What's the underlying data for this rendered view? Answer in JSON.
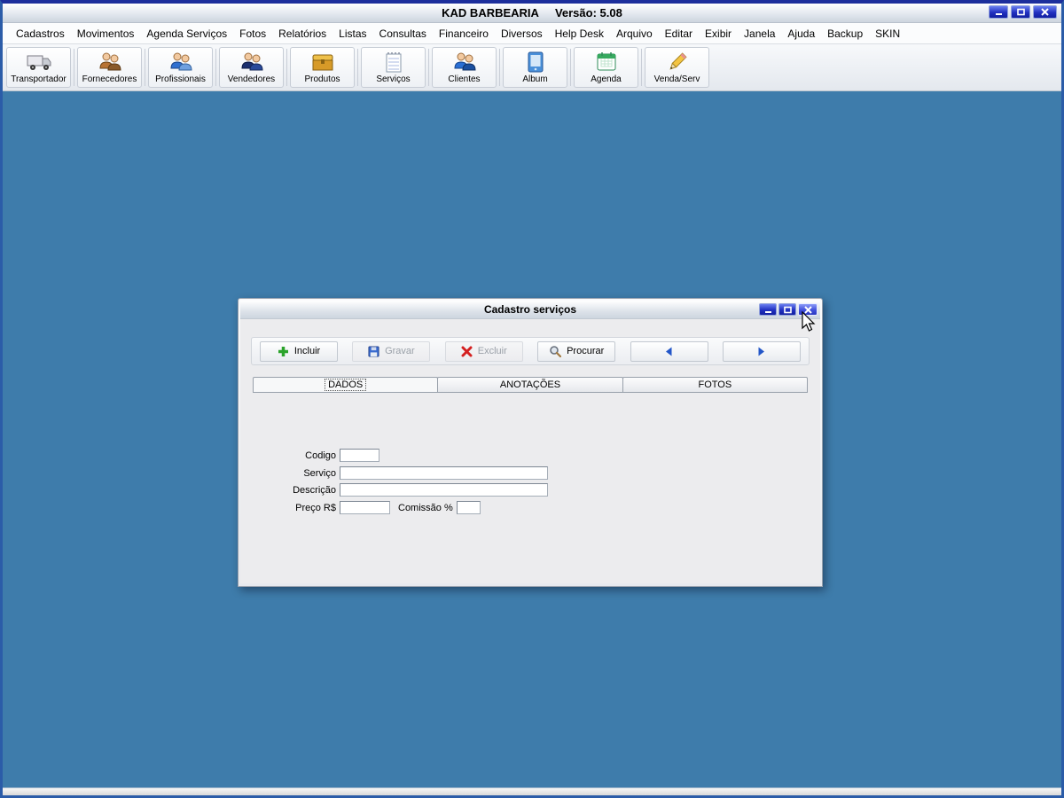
{
  "app": {
    "title": "KAD BARBEARIA",
    "version": "Versão: 5.08"
  },
  "menu": {
    "items": [
      "Cadastros",
      "Movimentos",
      "Agenda Serviços",
      "Fotos",
      "Relatórios",
      "Listas",
      "Consultas",
      "Financeiro",
      "Diversos",
      "Help Desk",
      "Arquivo",
      "Editar",
      "Exibir",
      "Janela",
      "Ajuda",
      "Backup",
      "SKIN"
    ]
  },
  "toolbar": {
    "buttons": [
      {
        "label": "Transportador",
        "icon": "truck-icon"
      },
      {
        "label": "Fornecedores",
        "icon": "suppliers-people-icon"
      },
      {
        "label": "Profissionais",
        "icon": "professionals-people-icon"
      },
      {
        "label": "Vendedores",
        "icon": "sellers-people-icon"
      },
      {
        "label": "Produtos",
        "icon": "chest-icon"
      },
      {
        "label": "Serviços",
        "icon": "notepad-icon"
      },
      {
        "label": "Clientes",
        "icon": "clients-people-icon"
      },
      {
        "label": "Album",
        "icon": "album-icon"
      },
      {
        "label": "Agenda",
        "icon": "calendar-icon"
      },
      {
        "label": "Venda/Serv",
        "icon": "pencil-icon"
      }
    ]
  },
  "dialog": {
    "title": "Cadastro serviços",
    "buttons": {
      "incluir": "Incluir",
      "gravar": "Gravar",
      "excluir": "Excluir",
      "procurar": "Procurar"
    },
    "tabs": [
      "DADOS",
      "ANOTAÇÕES",
      "FOTOS"
    ],
    "form": {
      "codigo": "Codigo",
      "servico": "Serviço",
      "descricao": "Descrição",
      "preco": "Preço R$",
      "comissao": "Comissão %"
    }
  },
  "colors": {
    "desktop": "#3e7cab",
    "control_button_blue": "#2130c0",
    "incluir_green": "#2ba32b",
    "excluir_red": "#d42020",
    "gravar_blue": "#3a6bd0"
  }
}
